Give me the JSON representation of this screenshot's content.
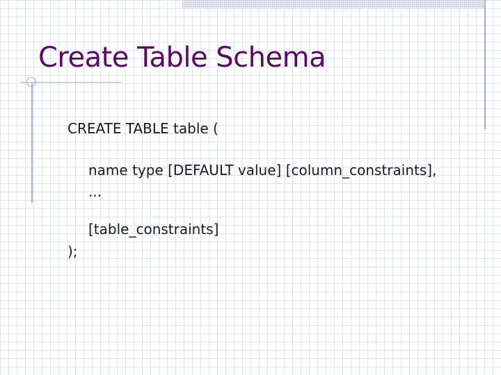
{
  "slide": {
    "title": "Create Table Schema",
    "lines": {
      "create": "CREATE TABLE table (",
      "column_def": "name type [DEFAULT value] [column_constraints],",
      "ellipsis": "...",
      "table_constraints": "[table_constraints]",
      "closing": ");"
    }
  },
  "colors": {
    "title": "#5a0a63",
    "grid": "#dde3ee",
    "accent_lines": "#9fb0cf"
  }
}
